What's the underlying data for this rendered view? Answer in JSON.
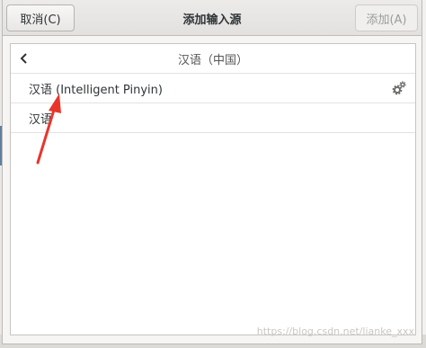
{
  "dialog": {
    "title": "添加输入源",
    "cancel_label": "取消(C)",
    "add_label": "添加(A)"
  },
  "list": {
    "header_label": "汉语（中国）",
    "items": [
      {
        "label": "汉语 (Intelligent Pinyin)",
        "has_settings": true
      },
      {
        "label": "汉语",
        "has_settings": false
      }
    ]
  },
  "watermark": "https://blog.csdn.net/lianke_xxx",
  "icons": {
    "back": "chevron-left-icon",
    "settings": "gear-icon"
  },
  "colors": {
    "annotation_arrow": "#e8352c",
    "headerbar": "#e7e5e3",
    "list_background": "#ffffff"
  }
}
